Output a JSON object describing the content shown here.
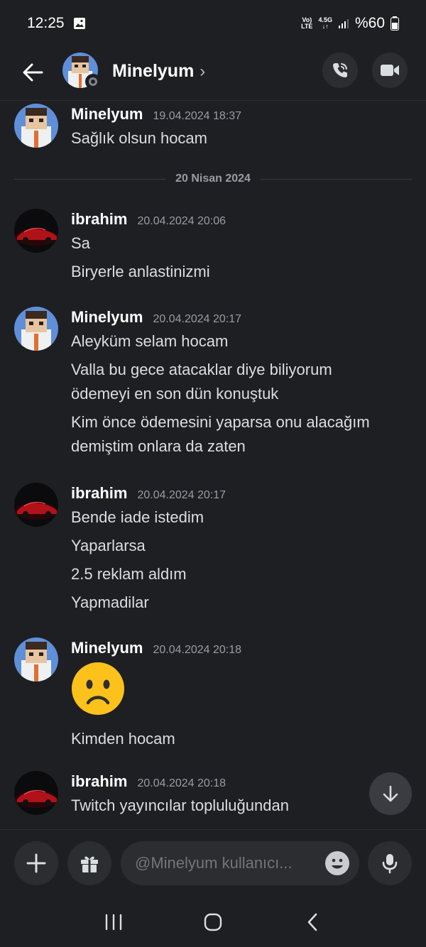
{
  "status": {
    "time": "12:25",
    "net_top": "Vo)",
    "net_bottom": "LTE",
    "net2_top": "4.5G",
    "net2_bottom": "↓↑",
    "battery": "%60"
  },
  "header": {
    "title": "Minelyum",
    "chevron": "›"
  },
  "day_divider": "20 Nisan 2024",
  "messages": [
    {
      "author": "Minelyum",
      "time": "19.04.2024 18:37",
      "lines": [
        "Sağlık olsun hocam"
      ]
    },
    {
      "author": "ibrahim",
      "time": "20.04.2024 20:06",
      "lines": [
        "Sa",
        "Biryerle anlastinizmi"
      ]
    },
    {
      "author": "Minelyum",
      "time": "20.04.2024 20:17",
      "lines": [
        "Aleyküm selam hocam",
        "Valla bu gece atacaklar diye biliyorum",
        "ödemeyi en son dün konuştuk",
        "Kim önce ödemesini yaparsa onu alacağım",
        "demiştim onlara da zaten"
      ]
    },
    {
      "author": "ibrahim",
      "time": "20.04.2024 20:17",
      "lines": [
        "Bende iade istedim",
        "Yaparlarsa",
        "2.5 reklam aldım",
        "Yapmadilar"
      ]
    },
    {
      "author": "Minelyum",
      "time": "20.04.2024 20:18",
      "emoji": "☹",
      "lines": [
        "Kimden hocam"
      ]
    },
    {
      "author": "ibrahim",
      "time": "20.04.2024 20:18",
      "lines": [
        "Twitch yayıncılar topluluğundan"
      ]
    }
  ],
  "composer": {
    "placeholder": "@Minelyum kullanıcı..."
  }
}
